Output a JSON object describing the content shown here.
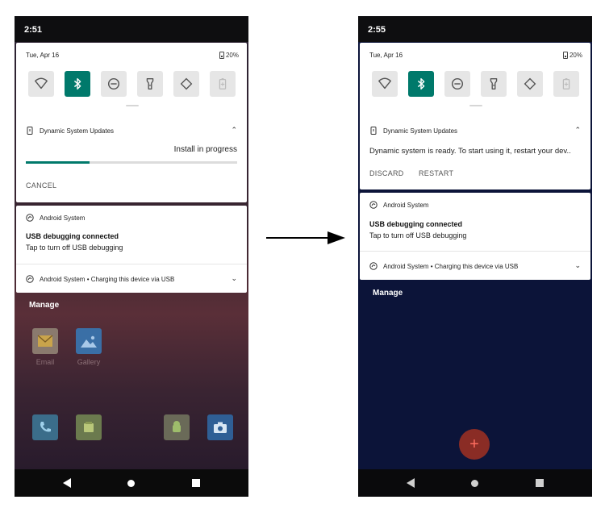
{
  "left": {
    "status_time": "2:51",
    "qs": {
      "date": "Tue, Apr 16",
      "battery": "20%"
    },
    "dsu": {
      "title": "Dynamic System Updates",
      "status": "Install in progress",
      "progress_percent": 30,
      "cancel_label": "CANCEL"
    },
    "android_system": {
      "app": "Android System",
      "title": "USB debugging connected",
      "text": "Tap to turn off USB debugging"
    },
    "charging": {
      "text": "Android System • Charging this device via USB"
    },
    "manage_label": "Manage",
    "apps": [
      {
        "label": "Email"
      },
      {
        "label": "Gallery"
      }
    ]
  },
  "right": {
    "status_time": "2:55",
    "qs": {
      "date": "Tue, Apr 16",
      "battery": "20%"
    },
    "dsu": {
      "title": "Dynamic System Updates",
      "text": "Dynamic system is ready. To start using it, restart your dev..",
      "discard_label": "DISCARD",
      "restart_label": "RESTART"
    },
    "android_system": {
      "app": "Android System",
      "title": "USB debugging connected",
      "text": "Tap to turn off USB debugging"
    },
    "charging": {
      "text": "Android System • Charging this device via USB"
    },
    "manage_label": "Manage",
    "fab_label": "+"
  },
  "icons": {
    "tiles": [
      "wifi-icon",
      "bluetooth-icon",
      "do-not-disturb-icon",
      "flashlight-icon",
      "auto-rotate-icon",
      "battery-saver-icon"
    ],
    "accent": "#00796b"
  }
}
